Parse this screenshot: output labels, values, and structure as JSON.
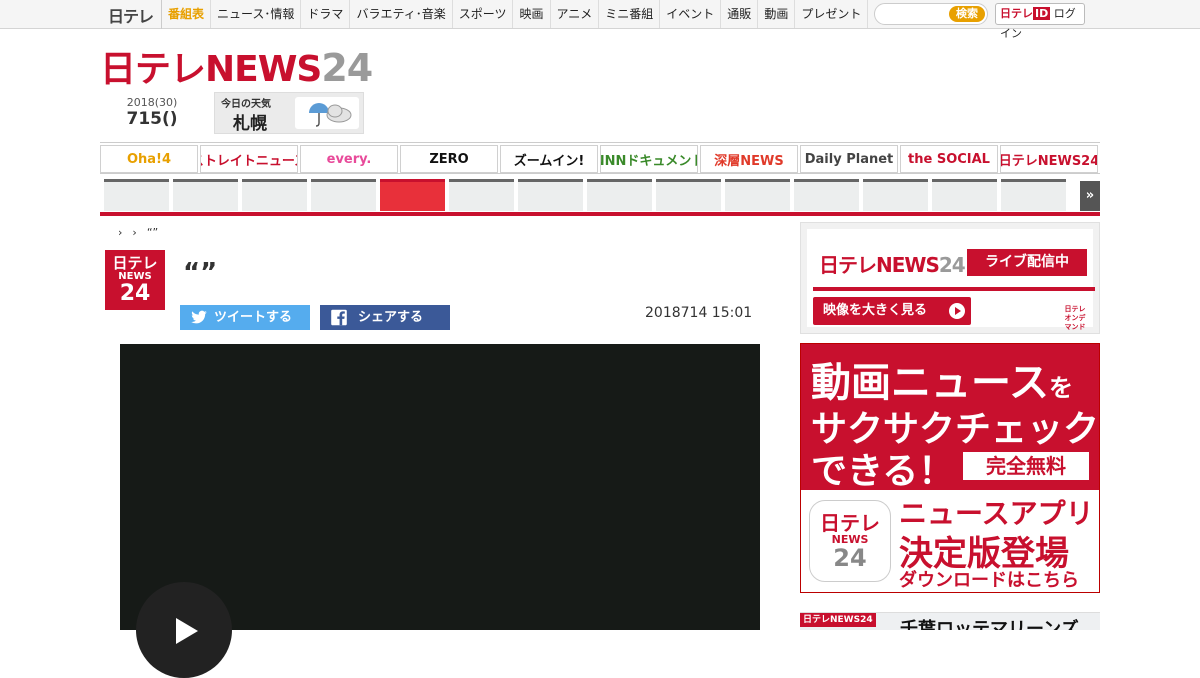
{
  "global_nav": {
    "logo": "日テレ",
    "items": [
      "番組表",
      "ニュース･情報",
      "ドラマ",
      "バラエティ･音楽",
      "スポーツ",
      "映画",
      "アニメ",
      "ミニ番組",
      "イベント",
      "通販",
      "動画",
      "プレゼント"
    ],
    "active_index": 0,
    "search_placeholder": "",
    "search_button": "検索",
    "login_logo": "日テレ",
    "login_id": "ID",
    "login_label": "ログイン"
  },
  "header": {
    "logo_red": "日テレNEWS",
    "logo_gray": "24",
    "date_year": "2018(30)",
    "date_md": "715()",
    "weather_label": "今日の天気",
    "weather_city": "札幌",
    "weather_icon": "umbrella-cloud-icon"
  },
  "programs": [
    {
      "name": "Oha!4",
      "color": "#e8a000"
    },
    {
      "name": "ストレイトニュース",
      "color": "#c8102e"
    },
    {
      "name": "every.",
      "color": "#e84a9a"
    },
    {
      "name": "ZERO",
      "color": "#111111"
    },
    {
      "name": "ズームイン!",
      "color": "#111111"
    },
    {
      "name": "NNNドキュメント",
      "color": "#3a8a2a"
    },
    {
      "name": "深層NEWS",
      "color": "#e03a2a"
    },
    {
      "name": "Daily Planet",
      "color": "#444444"
    },
    {
      "name": "the SOCIAL",
      "color": "#c8102e"
    },
    {
      "name": "日テレNEWS24",
      "color": "#c8102e"
    }
  ],
  "tabs": {
    "count": 14,
    "active_index": 4,
    "more_label": "»"
  },
  "article": {
    "breadcrumb": [
      "›",
      "›",
      "“”"
    ],
    "logo_top": "日テレ",
    "logo_mid": "NEWS",
    "logo_bottom": "24",
    "title": "“”",
    "tweet_label": "ツイートする",
    "share_label": "シェアする",
    "date": "2018714 15:01"
  },
  "sidebar": {
    "live_logo_red": "日テレNEWS",
    "live_logo_gray": "24",
    "live_badge": "ライブ配信中",
    "watch_label": "映像を大きく見る",
    "ondemand_label": "日テレ オンデマンド",
    "app_line1": "動画ニュース",
    "app_line1_small": "を",
    "app_line2": "サクサクチェック",
    "app_line3": "できる！",
    "app_free": "完全無料",
    "app_icon_a": "日テレ",
    "app_icon_b": "NEWS",
    "app_icon_c": "24",
    "app_b1": "ニュースアプリ",
    "app_b2": "決定版登場",
    "app_b3": "ダウンロードはこちら",
    "marines_logo": "日テレNEWS24",
    "marines_title": "千葉ロッテマリーンズ"
  }
}
